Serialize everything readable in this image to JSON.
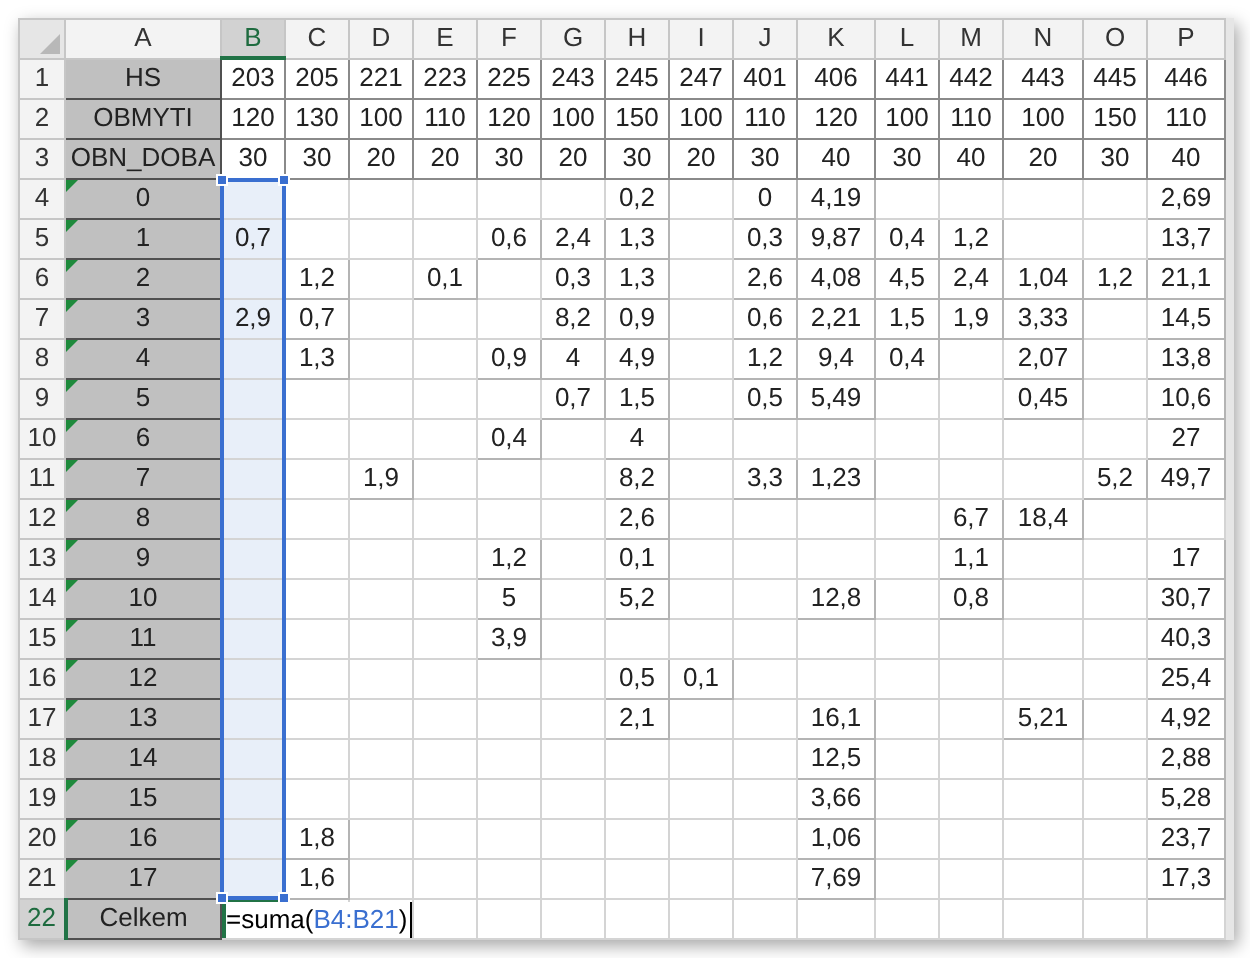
{
  "columns": [
    {
      "letter": "A",
      "selected": false,
      "referenced": false
    },
    {
      "letter": "B",
      "selected": true,
      "referenced": true
    },
    {
      "letter": "C",
      "selected": false,
      "referenced": false
    },
    {
      "letter": "D",
      "selected": false,
      "referenced": false
    },
    {
      "letter": "E",
      "selected": false,
      "referenced": false
    },
    {
      "letter": "F",
      "selected": false,
      "referenced": false
    },
    {
      "letter": "G",
      "selected": false,
      "referenced": false
    },
    {
      "letter": "H",
      "selected": false,
      "referenced": false
    },
    {
      "letter": "I",
      "selected": false,
      "referenced": false
    },
    {
      "letter": "J",
      "selected": false,
      "referenced": false
    },
    {
      "letter": "K",
      "selected": false,
      "referenced": false
    },
    {
      "letter": "L",
      "selected": false,
      "referenced": false
    },
    {
      "letter": "M",
      "selected": false,
      "referenced": false
    },
    {
      "letter": "N",
      "selected": false,
      "referenced": false
    },
    {
      "letter": "O",
      "selected": false,
      "referenced": false
    },
    {
      "letter": "P",
      "selected": false,
      "referenced": false
    }
  ],
  "rows": [
    {
      "number": "1",
      "label": "HS",
      "cells": {
        "B": "203",
        "C": "205",
        "D": "221",
        "E": "223",
        "F": "225",
        "G": "243",
        "H": "245",
        "I": "247",
        "J": "401",
        "K": "406",
        "L": "441",
        "M": "442",
        "N": "443",
        "O": "445",
        "P": "446"
      }
    },
    {
      "number": "2",
      "label": "OBMYTI",
      "cells": {
        "B": "120",
        "C": "130",
        "D": "100",
        "E": "110",
        "F": "120",
        "G": "100",
        "H": "150",
        "I": "100",
        "J": "110",
        "K": "120",
        "L": "100",
        "M": "110",
        "N": "100",
        "O": "150",
        "P": "110"
      }
    },
    {
      "number": "3",
      "label": "OBN_DOBA",
      "cells": {
        "B": "30",
        "C": "30",
        "D": "20",
        "E": "20",
        "F": "30",
        "G": "20",
        "H": "30",
        "I": "20",
        "J": "30",
        "K": "40",
        "L": "30",
        "M": "40",
        "N": "20",
        "O": "30",
        "P": "40"
      }
    },
    {
      "number": "4",
      "label": "0",
      "flagged": true,
      "cells": {
        "H": "0,2",
        "J": "0",
        "K": "4,19",
        "P": "2,69"
      }
    },
    {
      "number": "5",
      "label": "1",
      "flagged": true,
      "cells": {
        "B": "0,7",
        "F": "0,6",
        "G": "2,4",
        "H": "1,3",
        "J": "0,3",
        "K": "9,87",
        "L": "0,4",
        "M": "1,2",
        "P": "13,7"
      }
    },
    {
      "number": "6",
      "label": "2",
      "flagged": true,
      "cells": {
        "C": "1,2",
        "E": "0,1",
        "G": "0,3",
        "H": "1,3",
        "J": "2,6",
        "K": "4,08",
        "L": "4,5",
        "M": "2,4",
        "N": "1,04",
        "O": "1,2",
        "P": "21,1"
      }
    },
    {
      "number": "7",
      "label": "3",
      "flagged": true,
      "cells": {
        "B": "2,9",
        "C": "0,7",
        "G": "8,2",
        "H": "0,9",
        "J": "0,6",
        "K": "2,21",
        "L": "1,5",
        "M": "1,9",
        "N": "3,33",
        "P": "14,5"
      }
    },
    {
      "number": "8",
      "label": "4",
      "flagged": true,
      "cells": {
        "C": "1,3",
        "F": "0,9",
        "G": "4",
        "H": "4,9",
        "J": "1,2",
        "K": "9,4",
        "L": "0,4",
        "N": "2,07",
        "P": "13,8"
      }
    },
    {
      "number": "9",
      "label": "5",
      "flagged": true,
      "cells": {
        "G": "0,7",
        "H": "1,5",
        "J": "0,5",
        "K": "5,49",
        "N": "0,45",
        "P": "10,6"
      }
    },
    {
      "number": "10",
      "label": "6",
      "flagged": true,
      "cells": {
        "F": "0,4",
        "H": "4",
        "P": "27"
      }
    },
    {
      "number": "11",
      "label": "7",
      "flagged": true,
      "cells": {
        "D": "1,9",
        "H": "8,2",
        "J": "3,3",
        "K": "1,23",
        "O": "5,2",
        "P": "49,7"
      }
    },
    {
      "number": "12",
      "label": "8",
      "flagged": true,
      "cells": {
        "H": "2,6",
        "M": "6,7",
        "N": "18,4"
      }
    },
    {
      "number": "13",
      "label": "9",
      "flagged": true,
      "cells": {
        "F": "1,2",
        "H": "0,1",
        "M": "1,1",
        "P": "17"
      }
    },
    {
      "number": "14",
      "label": "10",
      "flagged": true,
      "cells": {
        "F": "5",
        "H": "5,2",
        "K": "12,8",
        "M": "0,8",
        "P": "30,7"
      }
    },
    {
      "number": "15",
      "label": "11",
      "flagged": true,
      "cells": {
        "F": "3,9",
        "P": "40,3"
      }
    },
    {
      "number": "16",
      "label": "12",
      "flagged": true,
      "cells": {
        "H": "0,5",
        "I": "0,1",
        "P": "25,4"
      }
    },
    {
      "number": "17",
      "label": "13",
      "flagged": true,
      "cells": {
        "H": "2,1",
        "K": "16,1",
        "N": "5,21",
        "P": "4,92"
      }
    },
    {
      "number": "18",
      "label": "14",
      "flagged": true,
      "cells": {
        "K": "12,5",
        "P": "2,88"
      }
    },
    {
      "number": "19",
      "label": "15",
      "flagged": true,
      "cells": {
        "K": "3,66",
        "P": "5,28"
      }
    },
    {
      "number": "20",
      "label": "16",
      "flagged": true,
      "cells": {
        "C": "1,8",
        "K": "1,06",
        "P": "23,7"
      }
    },
    {
      "number": "21",
      "label": "17",
      "flagged": true,
      "cells": {
        "C": "1,6",
        "K": "7,69",
        "P": "17,3"
      }
    }
  ],
  "total_row": {
    "number": "22",
    "label": "Celkem",
    "selected": true,
    "formula": {
      "prefix": "=suma(",
      "reference": "B4:B21",
      "suffix": ")"
    }
  }
}
